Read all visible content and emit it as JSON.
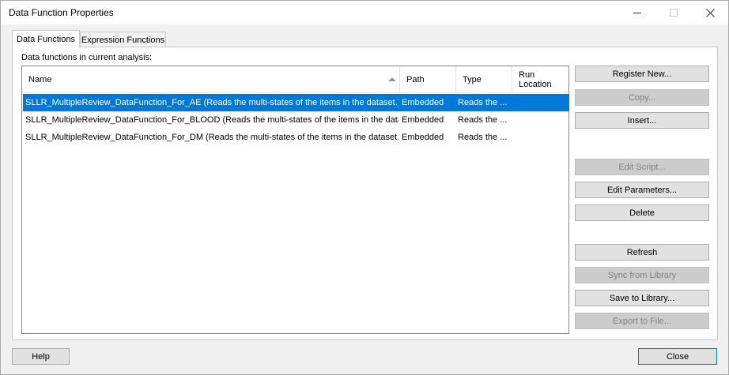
{
  "window": {
    "title": "Data Function Properties"
  },
  "tabs": [
    {
      "label": "Data Functions",
      "active": true
    },
    {
      "label": "Expression Functions",
      "active": false
    }
  ],
  "panel": {
    "label": "Data functions in current analysis:"
  },
  "list": {
    "columns": [
      "Name",
      "Path",
      "Type",
      "Run\nLocation"
    ],
    "sort_column": "Name",
    "rows": [
      {
        "name": "SLLR_MultipleReview_DataFunction_For_AE (Reads the multi-states of the items in the dataset.)",
        "path": "Embedded",
        "type": "Reads the ...",
        "run_location": "",
        "selected": true
      },
      {
        "name": "SLLR_MultipleReview_DataFunction_For_BLOOD (Reads the multi-states of the items in the data...",
        "path": "Embedded",
        "type": "Reads the ...",
        "run_location": "",
        "selected": false
      },
      {
        "name": "SLLR_MultipleReview_DataFunction_For_DM (Reads the multi-states of the items in the dataset.)",
        "path": "Embedded",
        "type": "Reads the ...",
        "run_location": "",
        "selected": false
      }
    ]
  },
  "buttons": {
    "register_new": "Register New...",
    "copy": "Copy...",
    "insert": "Insert...",
    "edit_script": "Edit Script...",
    "edit_parameters": "Edit Parameters...",
    "delete": "Delete",
    "refresh": "Refresh",
    "sync_from_library": "Sync from Library",
    "save_to_library": "Save to Library...",
    "export_to_file": "Export to File...",
    "help": "Help",
    "close": "Close"
  },
  "colors": {
    "selection": "#0078d7",
    "disabled_text": "#838383"
  }
}
